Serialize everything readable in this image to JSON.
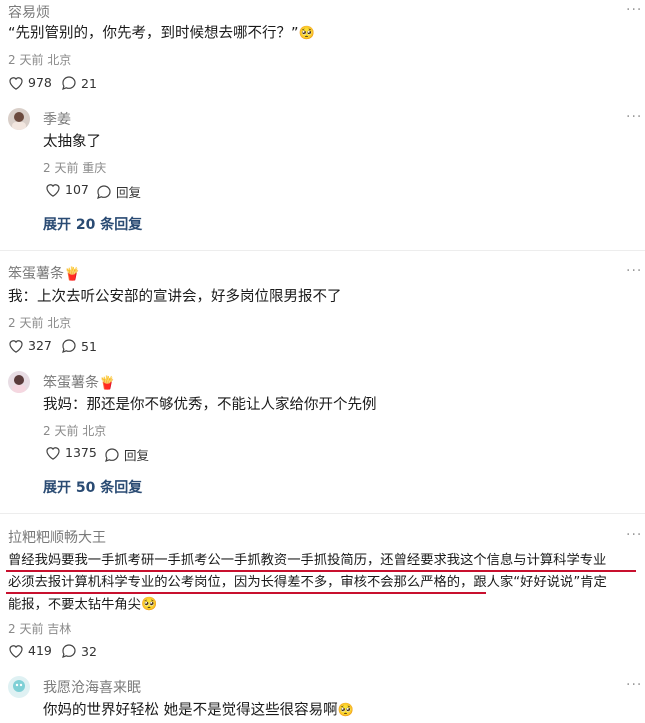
{
  "comments": [
    {
      "name": "容易烦",
      "text": "“先别管别的，你先考，到时候想去哪不行？”",
      "emoji": "🥺",
      "meta": "2 天前 北京",
      "likes": "978",
      "replies": "21",
      "reply": {
        "name": "季姜",
        "text": "太抽象了",
        "meta": "2 天前 重庆",
        "likes": "107",
        "reply_label": "回复"
      },
      "expand": "展开 20 条回复"
    },
    {
      "name": "笨蛋薯条",
      "name_emoji": "🍟",
      "text": "我：上次去听公安部的宣讲会，好多岗位限男报不了",
      "meta": "2 天前 北京",
      "likes": "327",
      "replies": "51",
      "reply": {
        "name": "笨蛋薯条",
        "name_emoji": "🍟",
        "text": "我妈：那还是你不够优秀，不能让人家给你开个先例",
        "meta": "2 天前 北京",
        "likes": "1375",
        "reply_label": "回复"
      },
      "expand": "展开 50 条回复"
    },
    {
      "name": "拉粑粑顺畅大王",
      "text_line1": "曾经我妈要我一手抓考研一手抓考公一手抓教资一手抓投简历，还曾经要求我这个信息与计算科学专业",
      "text_line2": "必须去报计算机科学专业的公考岗位，因为长得差不多，审核不会那么严格的，跟人家“好好说说”肯定",
      "text_line3": "能报，不要太钻牛角尖",
      "emoji": "🥺",
      "meta": "2 天前 吉林",
      "likes": "419",
      "replies": "32",
      "reply": {
        "name": "我愿沧海喜来眠",
        "text": "你妈的世界好轻松 她是不是觉得这些很容易啊",
        "emoji": "🥺"
      }
    }
  ],
  "menu_glyph": "···",
  "colors": {
    "accent_link": "#2a4b73",
    "underline": "#c8102e"
  }
}
